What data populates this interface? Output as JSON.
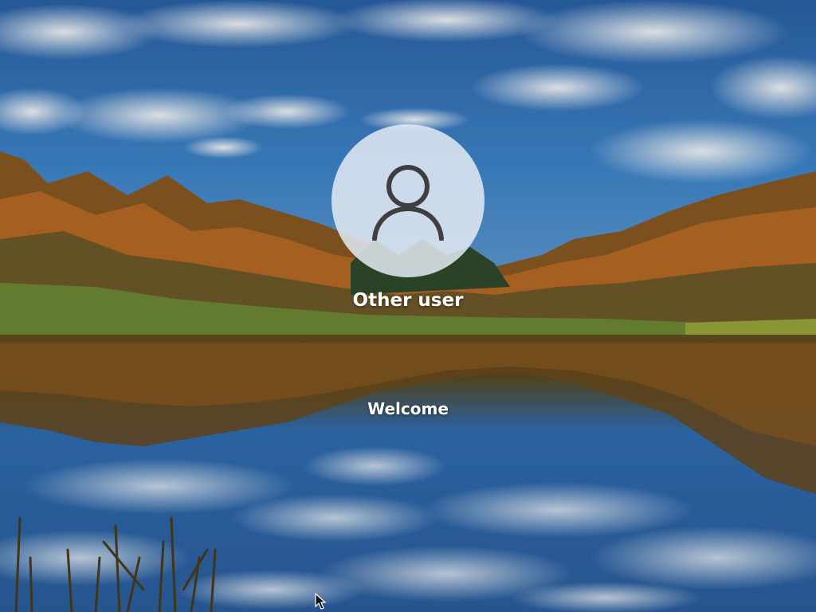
{
  "lock_screen": {
    "user_name": "Other user",
    "status": "Welcome",
    "avatar_icon": "user-silhouette-icon"
  },
  "wallpaper": {
    "subject": "autumn-lake-scene",
    "colors": {
      "sky": "#2f6fb5",
      "foliage": "#c0702a",
      "water": "#3a78b8"
    }
  }
}
